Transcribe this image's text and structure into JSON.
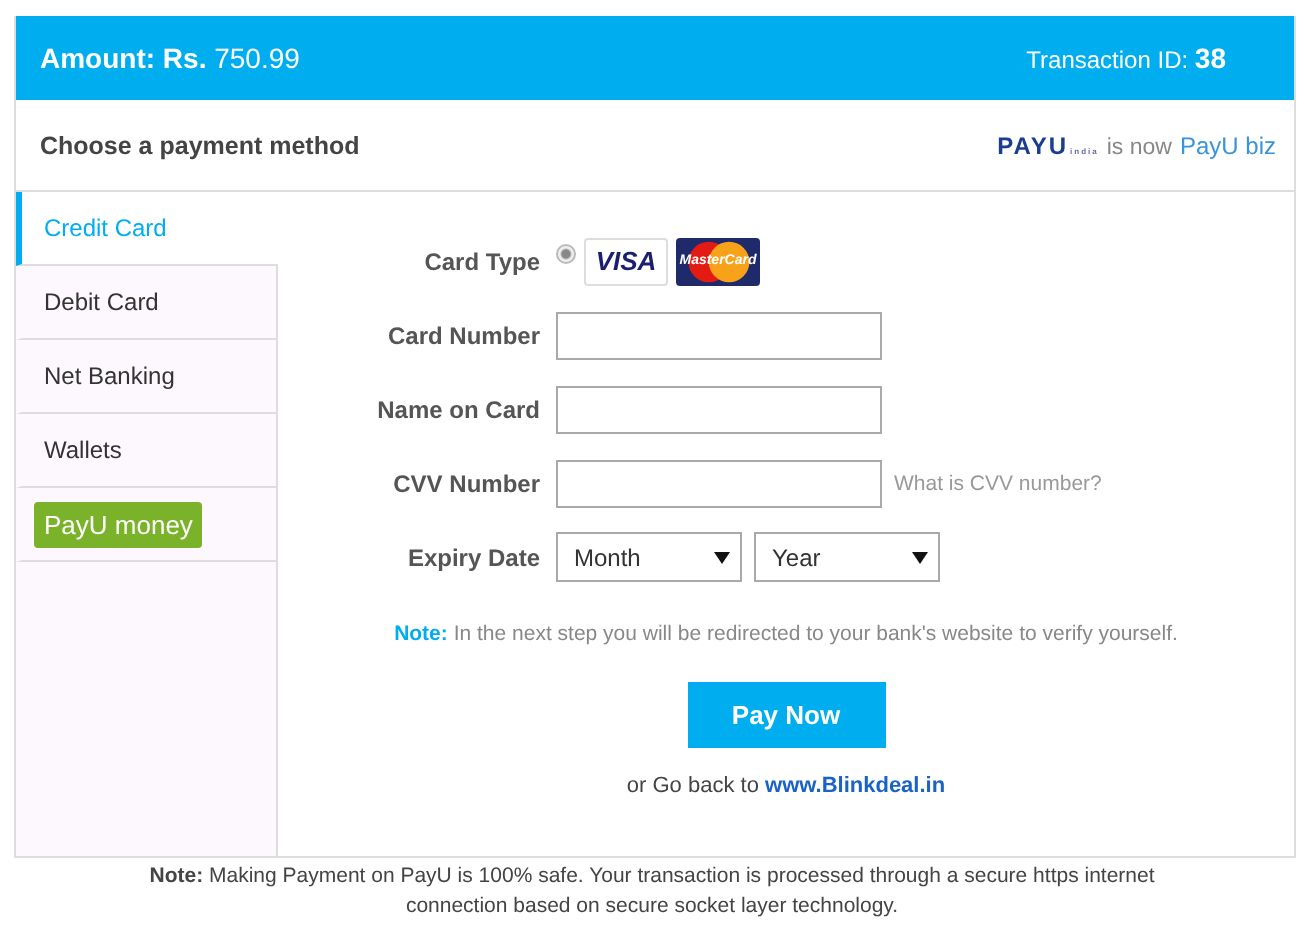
{
  "header": {
    "amount_label": "Amount: Rs.",
    "amount": "750.99",
    "transaction_label": "Transaction ID:",
    "transaction_id": "38"
  },
  "subheader": {
    "title": "Choose a payment method",
    "logo_old": "PAYU",
    "logo_old_sub": "india",
    "logo_text": "is now",
    "logo_new": "PayU",
    "logo_new_suffix": "biz"
  },
  "sidebar": {
    "items": [
      {
        "kind": "text",
        "label": "Credit Card",
        "selected": true
      },
      {
        "kind": "text",
        "label": "Debit Card",
        "selected": false
      },
      {
        "kind": "text",
        "label": "Net Banking",
        "selected": false
      },
      {
        "kind": "text",
        "label": "Wallets",
        "selected": false
      },
      {
        "kind": "logo",
        "label": "PayU",
        "suffix": "money",
        "selected": false
      }
    ]
  },
  "form": {
    "card_type": {
      "label": "Card Type",
      "checked": true,
      "brands": [
        {
          "kind": "visa",
          "label": "VISA"
        },
        {
          "kind": "mastercard",
          "label": "MasterCard"
        }
      ]
    },
    "fields": [
      {
        "kind": "input",
        "label": "Card Number"
      },
      {
        "kind": "input",
        "label": "Name on Card"
      },
      {
        "kind": "input",
        "label": "CVV Number",
        "help": "What is CVV number?"
      },
      {
        "kind": "selects",
        "label": "Expiry Date",
        "selects": [
          "Month",
          "Year"
        ]
      }
    ],
    "note_label": "Note:",
    "note": "In the next step you will be redirected to your bank's website to verify yourself.",
    "button": "Pay Now",
    "back_text": "or Go back to",
    "back_link": "www.Blinkdeal.in"
  },
  "footer": {
    "text": "**Note:** Making Payment on PayU is 100% safe. Your transaction is processed through a secure https internet connection based on secure socket layer technology."
  }
}
